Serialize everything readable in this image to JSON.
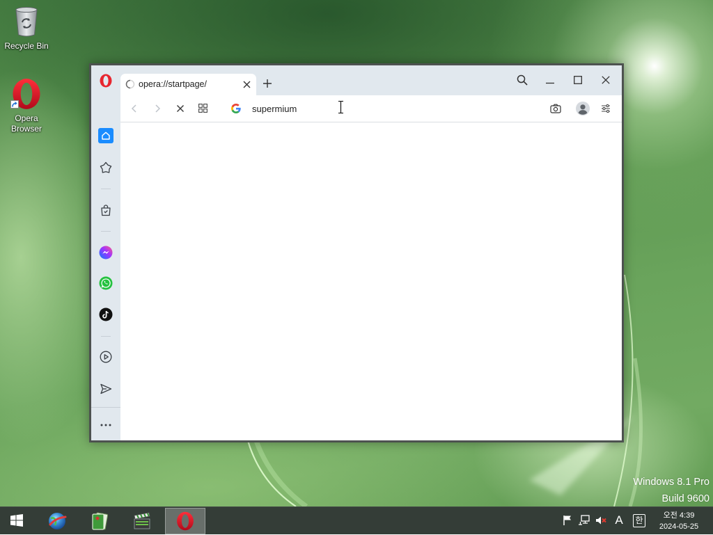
{
  "desktop": {
    "recycle_bin": {
      "label": "Recycle Bin",
      "icon": "recycle-bin-icon"
    },
    "opera_shortcut": {
      "label_line1": "Opera",
      "label_line2": "Browser",
      "icon": "opera-icon"
    },
    "watermark": {
      "line1": "Windows 8.1 Pro",
      "line2": "Build 9600"
    }
  },
  "browser": {
    "tab": {
      "title": "opera://startpage/",
      "loading": true
    },
    "toolbar": {
      "address_value": "supermium",
      "search_engine_icon": "google-icon"
    },
    "sidebar_items": [
      "home-icon",
      "pinboards-icon",
      "shopping-bag-icon",
      "messenger-icon",
      "whatsapp-icon",
      "tiktok-icon",
      "player-icon",
      "send-icon",
      "more-icon"
    ],
    "active_sidebar_item": "home-icon"
  },
  "taskbar": {
    "pinned_apps": [
      "globe-browser-icon",
      "cards-game-icon",
      "movie-maker-icon",
      "opera-icon"
    ],
    "active_app": "opera-icon",
    "tray": {
      "language_indicator": "A",
      "ime_indicator": "한",
      "time": "오전 4:39",
      "date": "2024-05-25",
      "volume_muted": true
    }
  },
  "colors": {
    "accent_blue": "#1a8cff",
    "opera_red": "#e8262f",
    "browser_chrome": "#e1e8ee",
    "taskbar": "#343d37"
  }
}
